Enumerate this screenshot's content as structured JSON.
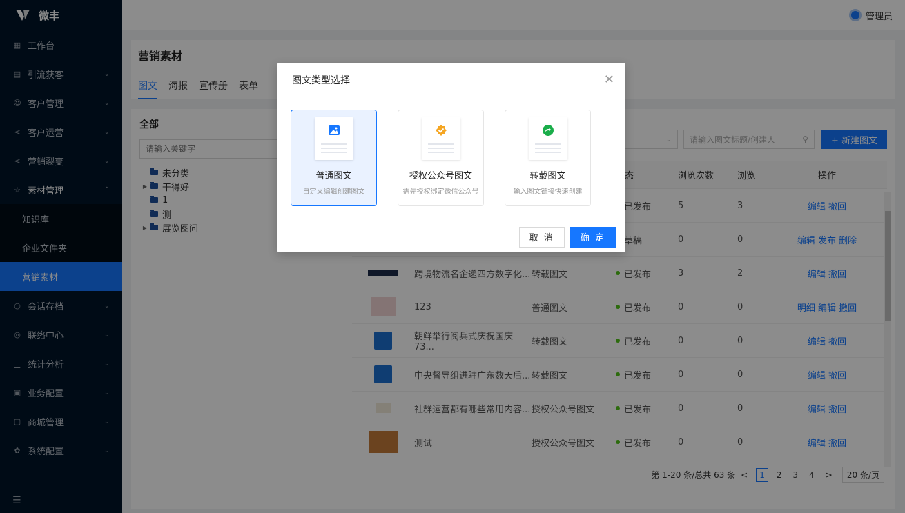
{
  "brand": {
    "name": "微丰"
  },
  "header": {
    "user_name": "管理员"
  },
  "sidebar": {
    "items": [
      {
        "label": "工作台",
        "icon": "grid-icon"
      },
      {
        "label": "引流获客",
        "icon": "chart-icon"
      },
      {
        "label": "客户管理",
        "icon": "users-icon"
      },
      {
        "label": "客户运营",
        "icon": "share-icon"
      },
      {
        "label": "营销裂变",
        "icon": "share-icon"
      },
      {
        "label": "素材管理",
        "icon": "star-icon"
      }
    ],
    "sub_items": [
      {
        "label": "知识库"
      },
      {
        "label": "企业文件夹"
      },
      {
        "label": "营销素材"
      }
    ],
    "items2": [
      {
        "label": "会话存档",
        "icon": "chat-icon"
      },
      {
        "label": "联络中心",
        "icon": "whatsapp-icon"
      },
      {
        "label": "统计分析",
        "icon": "bar-icon"
      },
      {
        "label": "业务配置",
        "icon": "config-icon"
      },
      {
        "label": "商城管理",
        "icon": "shop-icon"
      },
      {
        "label": "系统配置",
        "icon": "gear-icon"
      }
    ]
  },
  "page": {
    "title": "营销素材",
    "tabs": [
      "图文",
      "海报",
      "宣传册",
      "表单"
    ]
  },
  "left": {
    "title": "全部",
    "keyword_placeholder": "请输入关键字",
    "tree": [
      {
        "label": "未分类"
      },
      {
        "label": "干得好"
      },
      {
        "label": "1"
      },
      {
        "label": "测"
      },
      {
        "label": "展览图问"
      }
    ]
  },
  "toolbar": {
    "search_placeholder": "请输入图文标题/创建人",
    "new_button": "+ 新建图文"
  },
  "table": {
    "headers": {
      "status": "状态",
      "views": "浏览次数",
      "views2": "浏览",
      "ops": "操作"
    },
    "rows": [
      {
        "title": "",
        "type": "",
        "status": "已发布",
        "views": "5",
        "views2": "3",
        "ops": "编辑 撤回"
      },
      {
        "title": "",
        "type": "",
        "status": "草稿",
        "views": "0",
        "views2": "0",
        "ops": "编辑 发布 删除"
      },
      {
        "title": "跨境物流名企递四方数字化...",
        "type": "转载图文",
        "status": "已发布",
        "views": "3",
        "views2": "2",
        "ops": "编辑 撤回"
      },
      {
        "title": "123",
        "type": "普通图文",
        "status": "已发布",
        "views": "0",
        "views2": "0",
        "ops": "明细 编辑 撤回"
      },
      {
        "title": "朝鲜举行阅兵式庆祝国庆73...",
        "type": "转载图文",
        "status": "已发布",
        "views": "0",
        "views2": "0",
        "ops": "编辑 撤回"
      },
      {
        "title": "中央督导组进驻广东数天后...",
        "type": "转载图文",
        "status": "已发布",
        "views": "0",
        "views2": "0",
        "ops": "编辑 撤回"
      },
      {
        "title": "社群运营都有哪些常用内容...",
        "type": "授权公众号图文",
        "status": "已发布",
        "views": "0",
        "views2": "0",
        "ops": "编辑 撤回"
      },
      {
        "title": "测试",
        "type": "授权公众号图文",
        "status": "已发布",
        "views": "0",
        "views2": "0",
        "ops": "编辑 撤回"
      }
    ]
  },
  "pager": {
    "summary": "第 1-20 条/总共 63 条",
    "pages": [
      "1",
      "2",
      "3",
      "4"
    ],
    "page_size": "20 条/页"
  },
  "modal": {
    "title": "图文类型选择",
    "cards": [
      {
        "title": "普通图文",
        "desc": "自定义编辑创建图文",
        "icon": "image-icon"
      },
      {
        "title": "授权公众号图文",
        "desc": "需先授权绑定微信公众号",
        "icon": "badge-check-icon"
      },
      {
        "title": "转载图文",
        "desc": "输入图文链接快速创建",
        "icon": "forward-icon"
      }
    ],
    "cancel": "取 消",
    "ok": "确 定"
  },
  "colors": {
    "primary": "#1677ff",
    "sidebar": "#001529",
    "published": "#52c41a"
  }
}
